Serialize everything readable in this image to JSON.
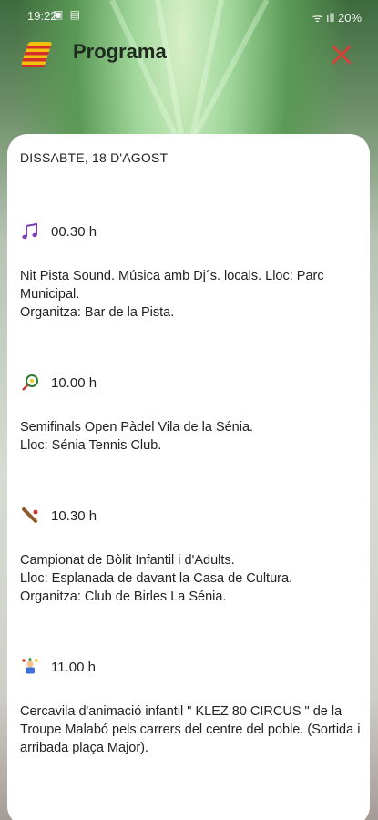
{
  "status": {
    "time": "19:22",
    "notif_icons": "▣ ▤",
    "right": "ᯤ ıll 20%"
  },
  "header": {
    "title": "Programa"
  },
  "program": {
    "date": "DISSABTE, 18 D'AGOST",
    "events": [
      {
        "icon": "music-note-icon",
        "time": "00.30 h",
        "description": "Nit Pista Sound. Música amb Dj´s. locals. Lloc: Parc Municipal.\nOrganitza: Bar de la Pista."
      },
      {
        "icon": "tennis-racket-icon",
        "time": "10.00 h",
        "description": "Semifinals Open Pàdel Vila de la Sénia.\nLloc: Sénia Tennis Club."
      },
      {
        "icon": "cricket-bat-icon",
        "time": "10.30 h",
        "description": "Campionat de Bòlit Infantil i d'Adults.\nLloc: Esplanada de davant la Casa de Cultura.\nOrganitza: Club de Birles La Sénia."
      },
      {
        "icon": "juggler-icon",
        "time": "11.00 h",
        "description": "Cercavila d'animació infantil \" KLEZ 80 CIRCUS \" de la Troupe Malabó pels carrers del centre del poble. (Sortida i arribada plaça Major)."
      }
    ]
  },
  "colors": {
    "accent": "#e53935",
    "music": "#7b3fb5"
  }
}
